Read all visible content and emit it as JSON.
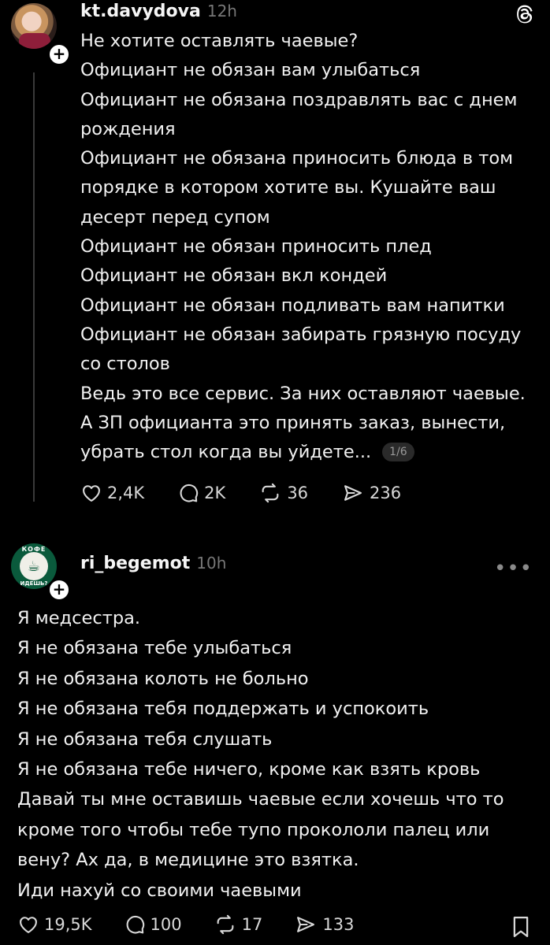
{
  "post1": {
    "username": "kt.davydova",
    "time": "12h",
    "lines": [
      "Не хотите оставлять чаевые?",
      "Официант не обязан вам улыбаться",
      "Официант не обязана поздравлять вас с днем",
      "рождения",
      "Официант не обязана приносить блюда в том",
      "порядке в котором хотите вы. Кушайте ваш",
      "десерт перед супом",
      "Официант не обязан приносить плед",
      "Официант не обязан вкл кондей",
      "Официант не обязан подливать вам напитки",
      "Официант не обязан забирать грязную посуду",
      "со столов",
      "Ведь это все сервис. За них оставляют чаевые.",
      "А ЗП официанта это принять заказ, вынести,",
      "убрать стол когда вы уйдете..."
    ],
    "pager": "1/6",
    "likes": "2,4K",
    "replies": "2K",
    "reposts": "36",
    "shares": "236"
  },
  "post2": {
    "username": "ri_begemot",
    "time": "10h",
    "avatar_text_top": "КОФЕ",
    "avatar_text_bottom": "ИДЕШЬ?",
    "lines": [
      "Я медсестра.",
      "Я не обязана тебе улыбаться",
      "Я не обязана колоть не больно",
      "Я не обязана тебя поддержать и успокоить",
      "Я не обязана тебя слушать",
      "Я не обязана тебе ничего, кроме как взять кровь",
      "Давай ты мне оставишь чаевые если хочешь что то",
      "кроме того чтобы тебе тупо прокололи палец или",
      "вену? Ах да, в медицине это взятка.",
      "Иди нахуй со своими чаевыми"
    ],
    "likes": "19,5K",
    "replies": "100",
    "reposts": "17",
    "shares": "133"
  },
  "icons": {
    "app": "threads-logo-icon",
    "like": "heart-icon",
    "reply": "comment-icon",
    "repost": "repost-icon",
    "share": "send-icon",
    "save": "bookmark-icon",
    "more": "more-dots-icon",
    "follow": "plus-icon"
  },
  "colors": {
    "background": "#000000",
    "text": "#f1f1f1",
    "muted": "#777777"
  }
}
